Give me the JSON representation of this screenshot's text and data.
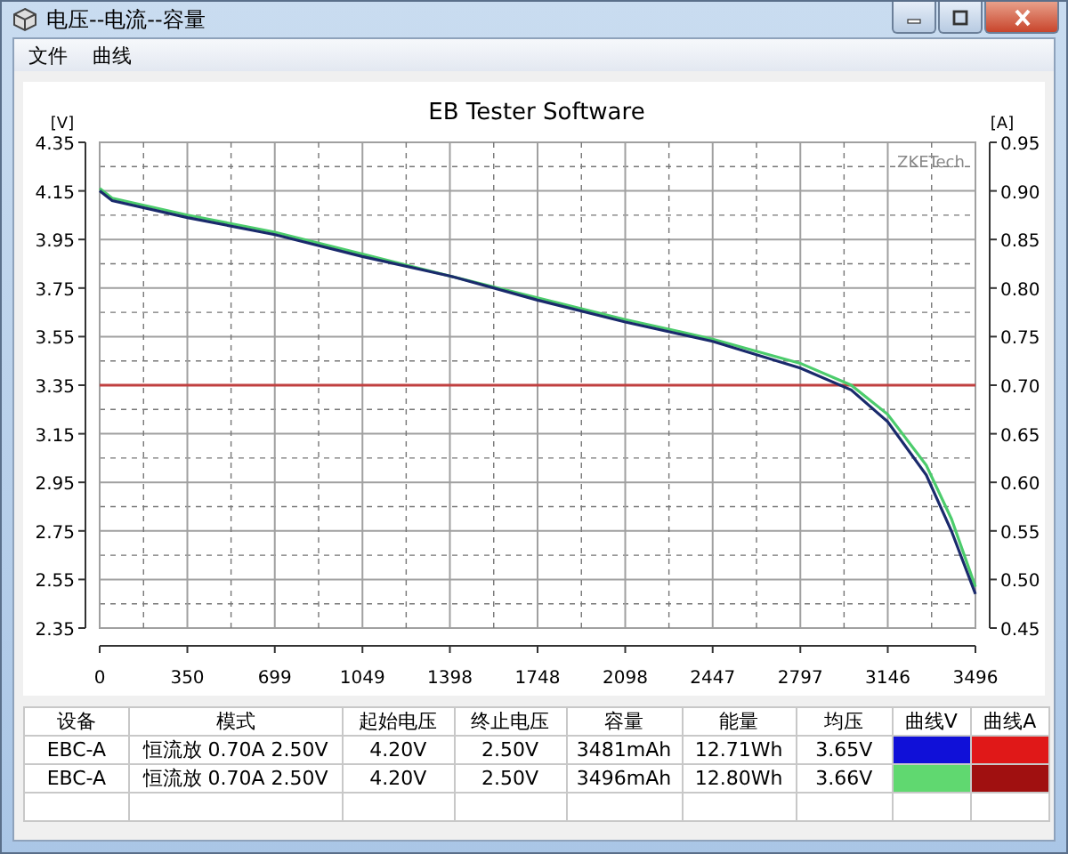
{
  "window": {
    "title": "电压--电流--容量"
  },
  "menu": [
    {
      "label": "文件"
    },
    {
      "label": "曲线"
    }
  ],
  "chart": {
    "brand_label": "ZKETech",
    "right_axis": {
      "label": "[A]",
      "ticks": [
        "0.95",
        "0.90",
        "0.85",
        "0.80",
        "0.75",
        "0.70",
        "0.65",
        "0.60",
        "0.55",
        "0.50",
        "0.45"
      ]
    },
    "chart_data": {
      "type": "line",
      "title": "EB Tester Software",
      "ylabel": "[V]",
      "x": [
        0,
        50,
        350,
        699,
        1049,
        1398,
        1748,
        2098,
        2447,
        2797,
        3000,
        3146,
        3300,
        3400,
        3496
      ],
      "xlim": [
        0,
        3496
      ],
      "ylim": [
        2.35,
        4.35
      ],
      "xticks": [
        0,
        350,
        699,
        1049,
        1398,
        1748,
        2098,
        2447,
        2797,
        3146,
        3496
      ],
      "yticks": [
        2.35,
        2.55,
        2.75,
        2.95,
        3.15,
        3.35,
        3.55,
        3.75,
        3.95,
        4.15,
        4.35
      ],
      "series": [
        {
          "color": "#4ccc6c",
          "values": [
            4.16,
            4.12,
            4.05,
            3.98,
            3.89,
            3.8,
            3.71,
            3.62,
            3.54,
            3.44,
            3.35,
            3.23,
            3.02,
            2.8,
            2.52
          ]
        },
        {
          "color": "#1a2a6c",
          "values": [
            4.15,
            4.11,
            4.04,
            3.97,
            3.88,
            3.8,
            3.7,
            3.61,
            3.53,
            3.42,
            3.33,
            3.2,
            2.98,
            2.75,
            2.49
          ]
        }
      ],
      "grid": true,
      "ref_lines": [
        {
          "axis": "y",
          "value": 3.35,
          "color": "#c04040"
        }
      ]
    }
  },
  "table": {
    "columns": [
      "设备",
      "模式",
      "起始电压",
      "终止电压",
      "容量",
      "能量",
      "均压",
      "曲线V",
      "曲线A"
    ],
    "rows": [
      {
        "cells": [
          "EBC-A",
          "恒流放  0.70A  2.50V",
          "4.20V",
          "2.50V",
          "3481mAh",
          "12.71Wh",
          "3.65V"
        ],
        "curves": [
          {
            "color": "#1010d8"
          },
          {
            "color": "#e01818"
          }
        ]
      },
      {
        "cells": [
          "EBC-A",
          "恒流放  0.70A  2.50V",
          "4.20V",
          "2.50V",
          "3496mAh",
          "12.80Wh",
          "3.66V"
        ],
        "curves": [
          {
            "color": "#60d870"
          },
          {
            "color": "#a01010"
          }
        ]
      }
    ]
  }
}
